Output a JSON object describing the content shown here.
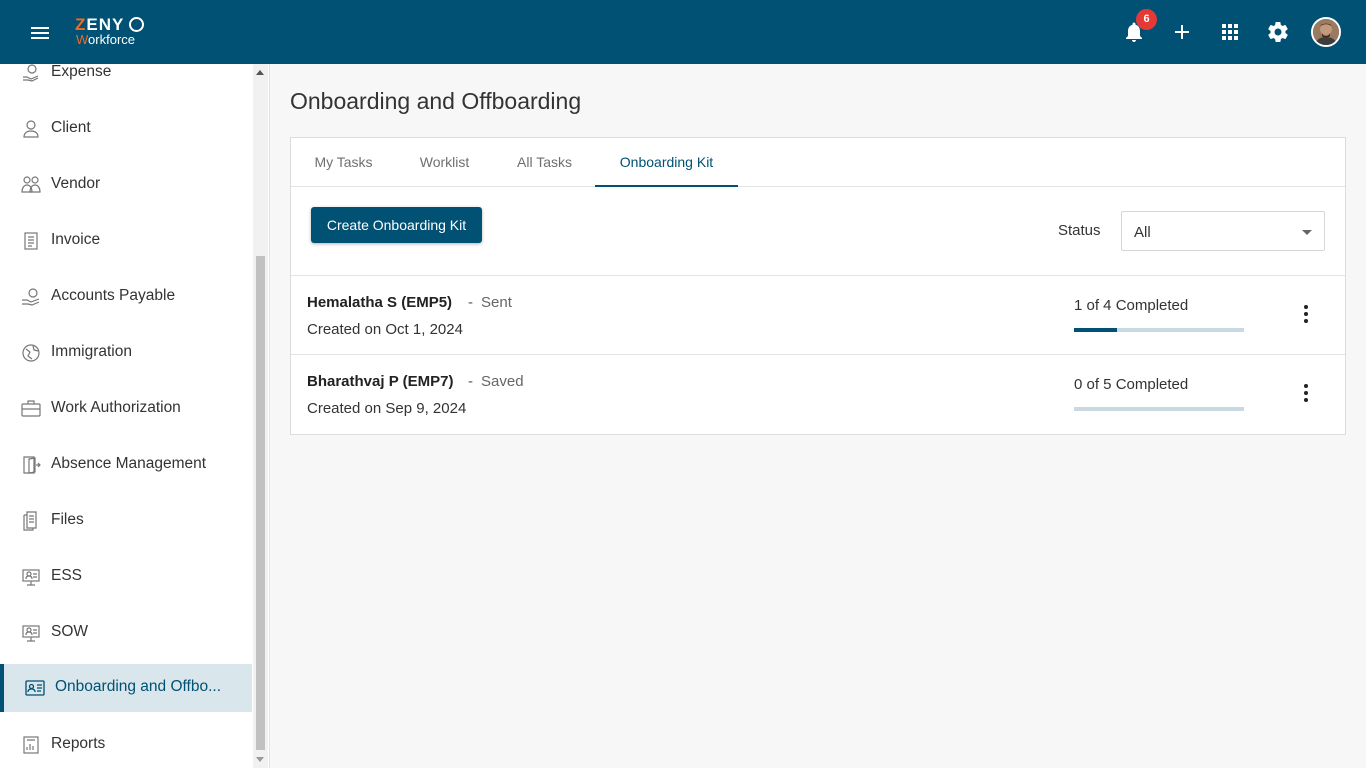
{
  "app": {
    "logo_top": "ZENYO",
    "logo_bottom": "Workforce",
    "notifications_count": "6"
  },
  "sidebar": {
    "items": [
      {
        "label": "Expense",
        "icon": "expense-icon"
      },
      {
        "label": "Client",
        "icon": "client-icon"
      },
      {
        "label": "Vendor",
        "icon": "vendor-icon"
      },
      {
        "label": "Invoice",
        "icon": "invoice-icon"
      },
      {
        "label": "Accounts Payable",
        "icon": "accounts-payable-icon"
      },
      {
        "label": "Immigration",
        "icon": "immigration-icon"
      },
      {
        "label": "Work Authorization",
        "icon": "work-authorization-icon"
      },
      {
        "label": "Absence Management",
        "icon": "absence-icon"
      },
      {
        "label": "Files",
        "icon": "files-icon"
      },
      {
        "label": "ESS",
        "icon": "ess-icon"
      },
      {
        "label": "SOW",
        "icon": "sow-icon"
      },
      {
        "label": "Onboarding and Offbo...",
        "icon": "onboarding-icon",
        "active": true
      },
      {
        "label": "Reports",
        "icon": "reports-icon"
      }
    ]
  },
  "main": {
    "title": "Onboarding and Offboarding",
    "tabs": [
      {
        "label": "My Tasks"
      },
      {
        "label": "Worklist"
      },
      {
        "label": "All Tasks"
      },
      {
        "label": "Onboarding Kit",
        "active": true
      }
    ],
    "create_button": "Create Onboarding Kit",
    "status_label": "Status",
    "status_value": "All",
    "rows": [
      {
        "name": "Hemalatha S (EMP5)",
        "separator": "-",
        "state": "Sent",
        "created": "Created on Oct 1, 2024",
        "progress": "1 of 4 Completed",
        "progress_fraction": 0.25
      },
      {
        "name": "Bharathvaj P (EMP7)",
        "separator": "-",
        "state": "Saved",
        "created": "Created on Sep 9, 2024",
        "progress": "0 of 5 Completed",
        "progress_fraction": 0
      }
    ]
  },
  "colors": {
    "brand": "#005173",
    "accent": "#f26b21",
    "badge": "#e53935"
  }
}
